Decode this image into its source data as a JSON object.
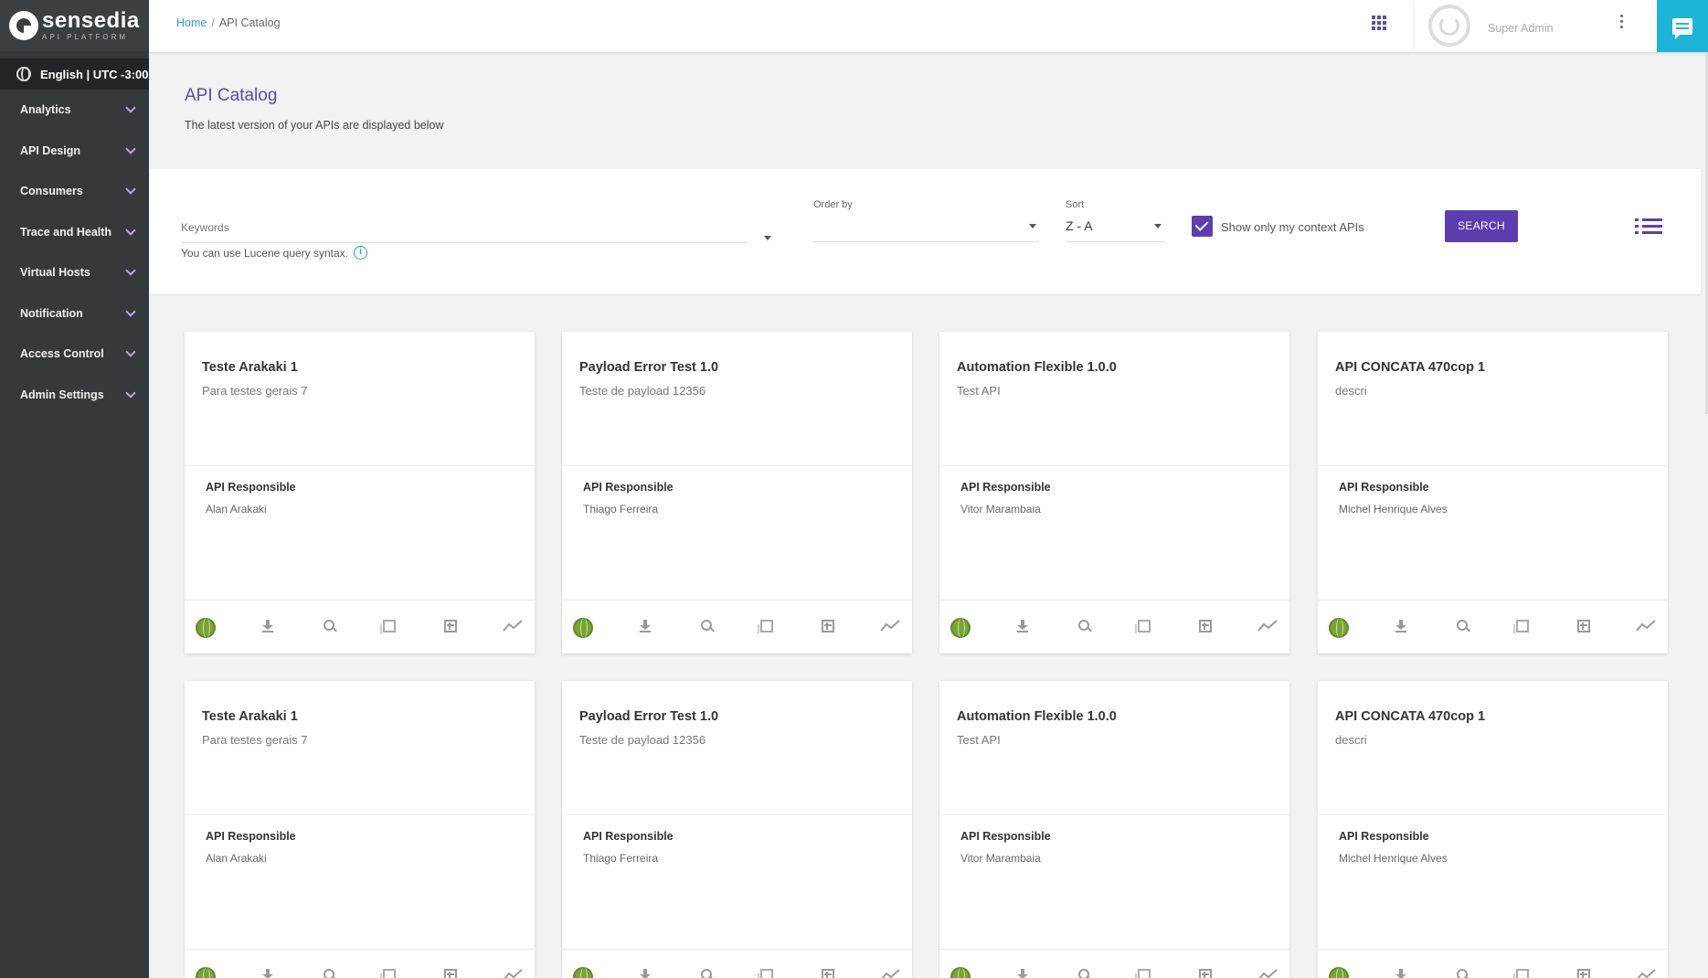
{
  "brand": {
    "name": "sensedia",
    "sub": "API PLATFORM"
  },
  "language": "English | UTC -3:00",
  "sidebar": {
    "items": [
      {
        "label": "Analytics"
      },
      {
        "label": "API Design"
      },
      {
        "label": "Consumers"
      },
      {
        "label": "Trace and Health"
      },
      {
        "label": "Virtual Hosts"
      },
      {
        "label": "Notification"
      },
      {
        "label": "Access Control"
      },
      {
        "label": "Admin Settings"
      }
    ]
  },
  "breadcrumb": {
    "home": "Home",
    "separator": "/",
    "current": "API Catalog"
  },
  "user": {
    "name": "Super Admin"
  },
  "page": {
    "title": "API Catalog",
    "subtitle": "The latest version of your APIs are displayed below"
  },
  "filter": {
    "keywords_label": "Keywords",
    "keywords_hint": "You can use Lucene query syntax.",
    "order_label": "Order by",
    "order_value": "",
    "sort_label": "Sort",
    "sort_value": "Z - A",
    "context_label": "Show only my context APIs",
    "context_checked": true,
    "search_label": "SEARCH"
  },
  "cards": [
    {
      "title": "Teste Arakaki 1",
      "description": "Para testes gerais 7",
      "resp_label": "API Responsible",
      "resp_name": "Alan Arakaki"
    },
    {
      "title": "Payload Error Test 1.0",
      "description": "Teste de payload 12356",
      "resp_label": "API Responsible",
      "resp_name": "Thiago Ferreira"
    },
    {
      "title": "Automation Flexible 1.0.0",
      "description": "Test API",
      "resp_label": "API Responsible",
      "resp_name": "Vitor Marambaia"
    },
    {
      "title": "API CONCATA 470cop 1",
      "description": "descri",
      "resp_label": "API Responsible",
      "resp_name": "Michel Henrique Alves"
    },
    {
      "title": "Teste Arakaki 1",
      "description": "Para testes gerais 7",
      "resp_label": "API Responsible",
      "resp_name": "Alan Arakaki"
    },
    {
      "title": "Payload Error Test 1.0",
      "description": "Teste de payload 12356",
      "resp_label": "API Responsible",
      "resp_name": "Thiago Ferreira"
    },
    {
      "title": "Automation Flexible 1.0.0",
      "description": "Test API",
      "resp_label": "API Responsible",
      "resp_name": "Vitor Marambaia"
    },
    {
      "title": "API CONCATA 470cop 1",
      "description": "descri",
      "resp_label": "API Responsible",
      "resp_name": "Michel Henrique Alves"
    }
  ],
  "colors": {
    "accent": "#5b3fb0",
    "sidebar": "#36393c",
    "chat": "#1eb4d8",
    "link": "#2d9cd6",
    "status_green": "#7aa435"
  }
}
